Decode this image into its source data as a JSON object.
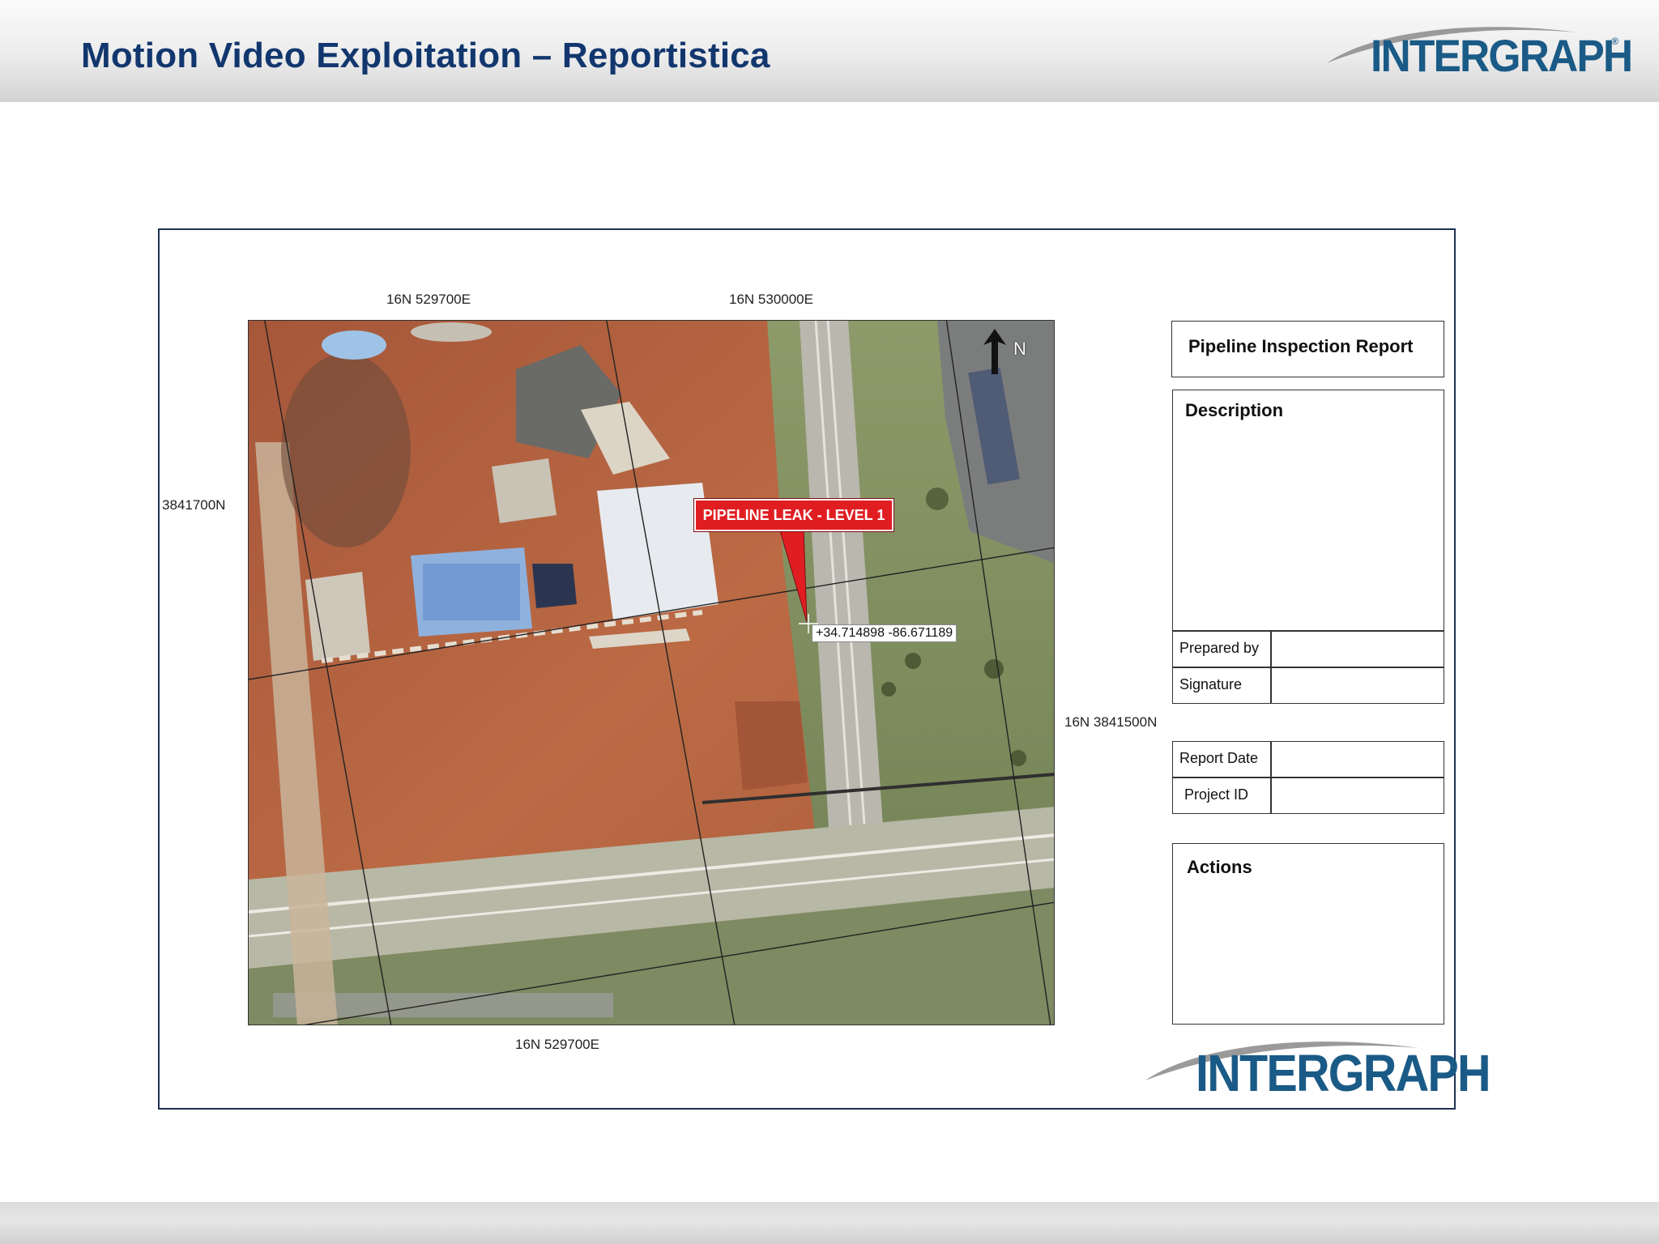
{
  "header": {
    "title": "Motion Video Exploitation – Reportistica",
    "logo_text": "INTERGRAPH",
    "logo_reg": "®"
  },
  "map": {
    "grid_labels": {
      "top_left": "16N 529700E",
      "top_right": "16N 530000E",
      "bottom": "16N 529700E",
      "left": "3841700N",
      "right": "16N 3841500N"
    },
    "north_label": "N",
    "callout_text": "PIPELINE LEAK - LEVEL 1",
    "coordinate_readout": "+34.714898 -86.671189",
    "colors": {
      "callout": "#e01e22",
      "soil": "#b4623a",
      "vegetation": "#7f8f5c",
      "road": "#b9b7ae"
    }
  },
  "report": {
    "title": "Pipeline Inspection Report",
    "description_label": "Description",
    "prepared_by_label": "Prepared by",
    "signature_label": "Signature",
    "report_date_label": "Report Date",
    "project_id_label": "Project ID",
    "actions_label": "Actions",
    "logo_text": "INTERGRAPH"
  }
}
